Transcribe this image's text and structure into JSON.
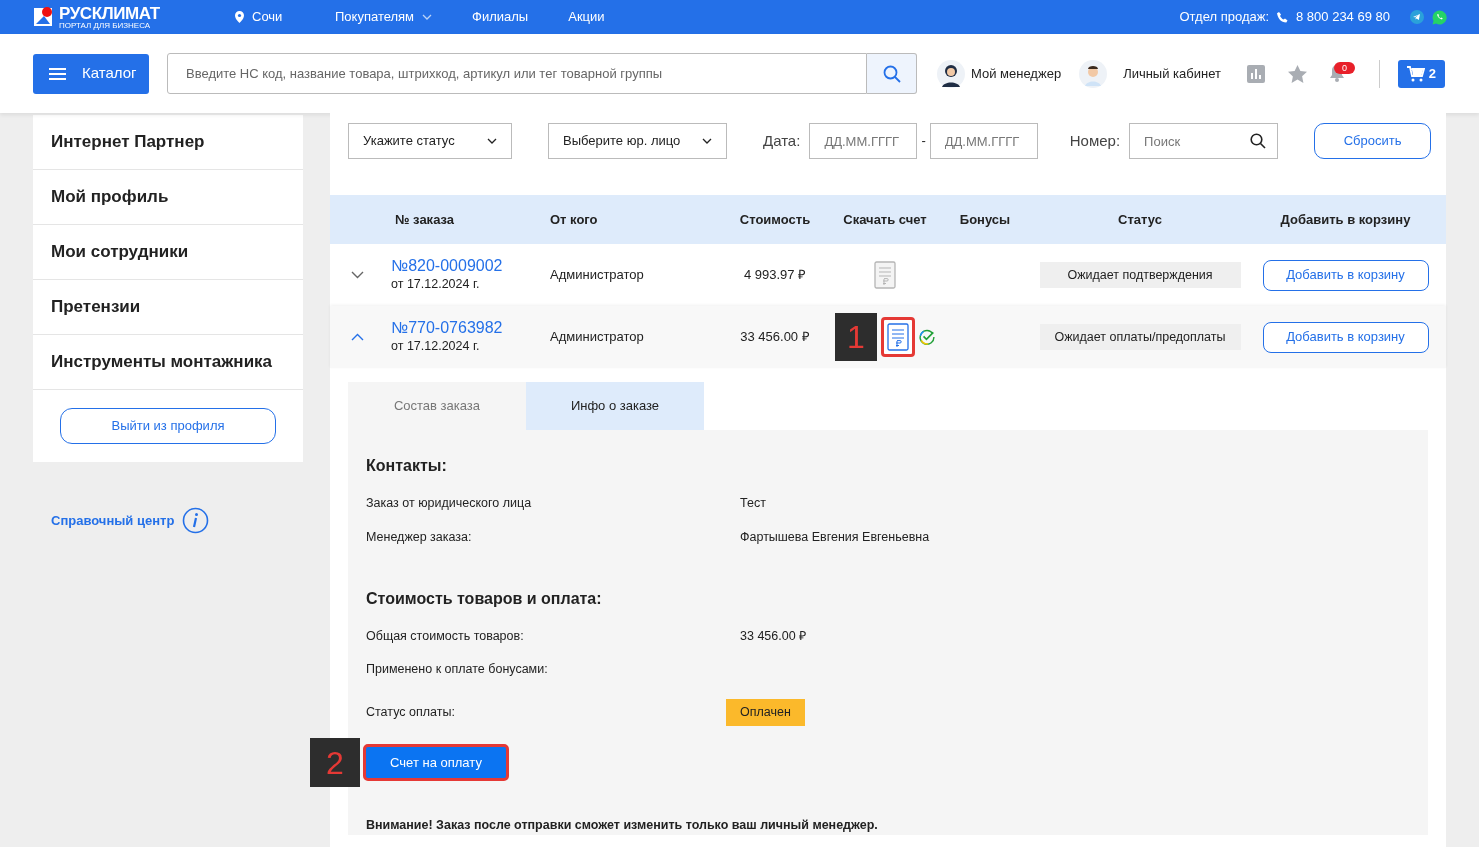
{
  "top_bar": {
    "logo": {
      "name": "РУСКЛИМАТ",
      "tagline": "ПОРТАЛ ДЛЯ БИЗНЕСА"
    },
    "city": "Сочи",
    "nav": [
      {
        "label": "Покупателям",
        "dropdown": true
      },
      {
        "label": "Филиалы",
        "dropdown": false
      },
      {
        "label": "Акции",
        "dropdown": false
      }
    ],
    "sales_label": "Отдел продаж:",
    "phone": "8 800 234 69 80"
  },
  "header": {
    "catalog_button": "Каталог",
    "search": {
      "placeholder": "Введите НС код, название товара, штрихкод, артикул или тег товарной группы"
    },
    "manager": "Мой менеджер",
    "cabinet": "Личный кабинет",
    "notifications_count": "0",
    "cart_count": "2"
  },
  "sidebar": {
    "items": [
      "Интернет Партнер",
      "Мой профиль",
      "Мои сотрудники",
      "Претензии",
      "Инструменты монтажника"
    ],
    "logout_button": "Выйти из профиля",
    "help_link": "Справочный центр"
  },
  "filters": {
    "status_select": "Укажите статус",
    "entity_select": "Выберите юр. лицо",
    "date_label": "Дата:",
    "date_from": {
      "placeholder": "ДД.ММ.ГГГГ"
    },
    "date_separator": "-",
    "date_to": {
      "placeholder": "ДД.ММ.ГГГГ"
    },
    "number_label": "Номер:",
    "number": {
      "placeholder": "Поиск"
    },
    "reset_button": "Сбросить"
  },
  "table": {
    "columns": [
      "№ заказа",
      "От кого",
      "Стоимость",
      "Скачать счет",
      "Бонусы",
      "Статус",
      "Добавить в корзину"
    ],
    "rows": [
      {
        "number": "№820-0009002",
        "date": "от 17.12.2024 г.",
        "from": "Администратор",
        "cost": "4 993.97 ₽",
        "invoice_active": false,
        "paid_mark": false,
        "status": "Ожидает подтверждения",
        "add_button": "Добавить в корзину",
        "expanded": false
      },
      {
        "number": "№770-0763982",
        "date": "от 17.12.2024 г.",
        "from": "Администратор",
        "cost": "33 456.00 ₽",
        "invoice_active": true,
        "paid_mark": true,
        "callout": "1",
        "status": "Ожидает оплаты/предоплаты",
        "add_button": "Добавить в корзину",
        "expanded": true
      }
    ]
  },
  "details": {
    "tabs": [
      {
        "label": "Состав заказа",
        "selected": false
      },
      {
        "label": "Инфо о заказе",
        "selected": true
      }
    ],
    "contacts_heading": "Контакты:",
    "contacts": [
      {
        "label": "Заказ от юридического лица",
        "value": "Тест"
      },
      {
        "label": "Менеджер заказа:",
        "value": "Фартышева Евгения Евгеньевна"
      }
    ],
    "cost_heading": "Стоимость товаров и оплата:",
    "cost_fields": [
      {
        "label": "Общая стоимость товаров:",
        "value": "33 456.00 ₽"
      },
      {
        "label": "Применено к оплате бонусами:"
      }
    ],
    "payment_status_label": "Статус оплаты:",
    "payment_status": "Оплачен",
    "invoice_button": {
      "label": "Счет на оплату",
      "callout": "2"
    },
    "notice": "Внимание! Заказ после отправки сможет изменить только ваш личный менеджер."
  }
}
